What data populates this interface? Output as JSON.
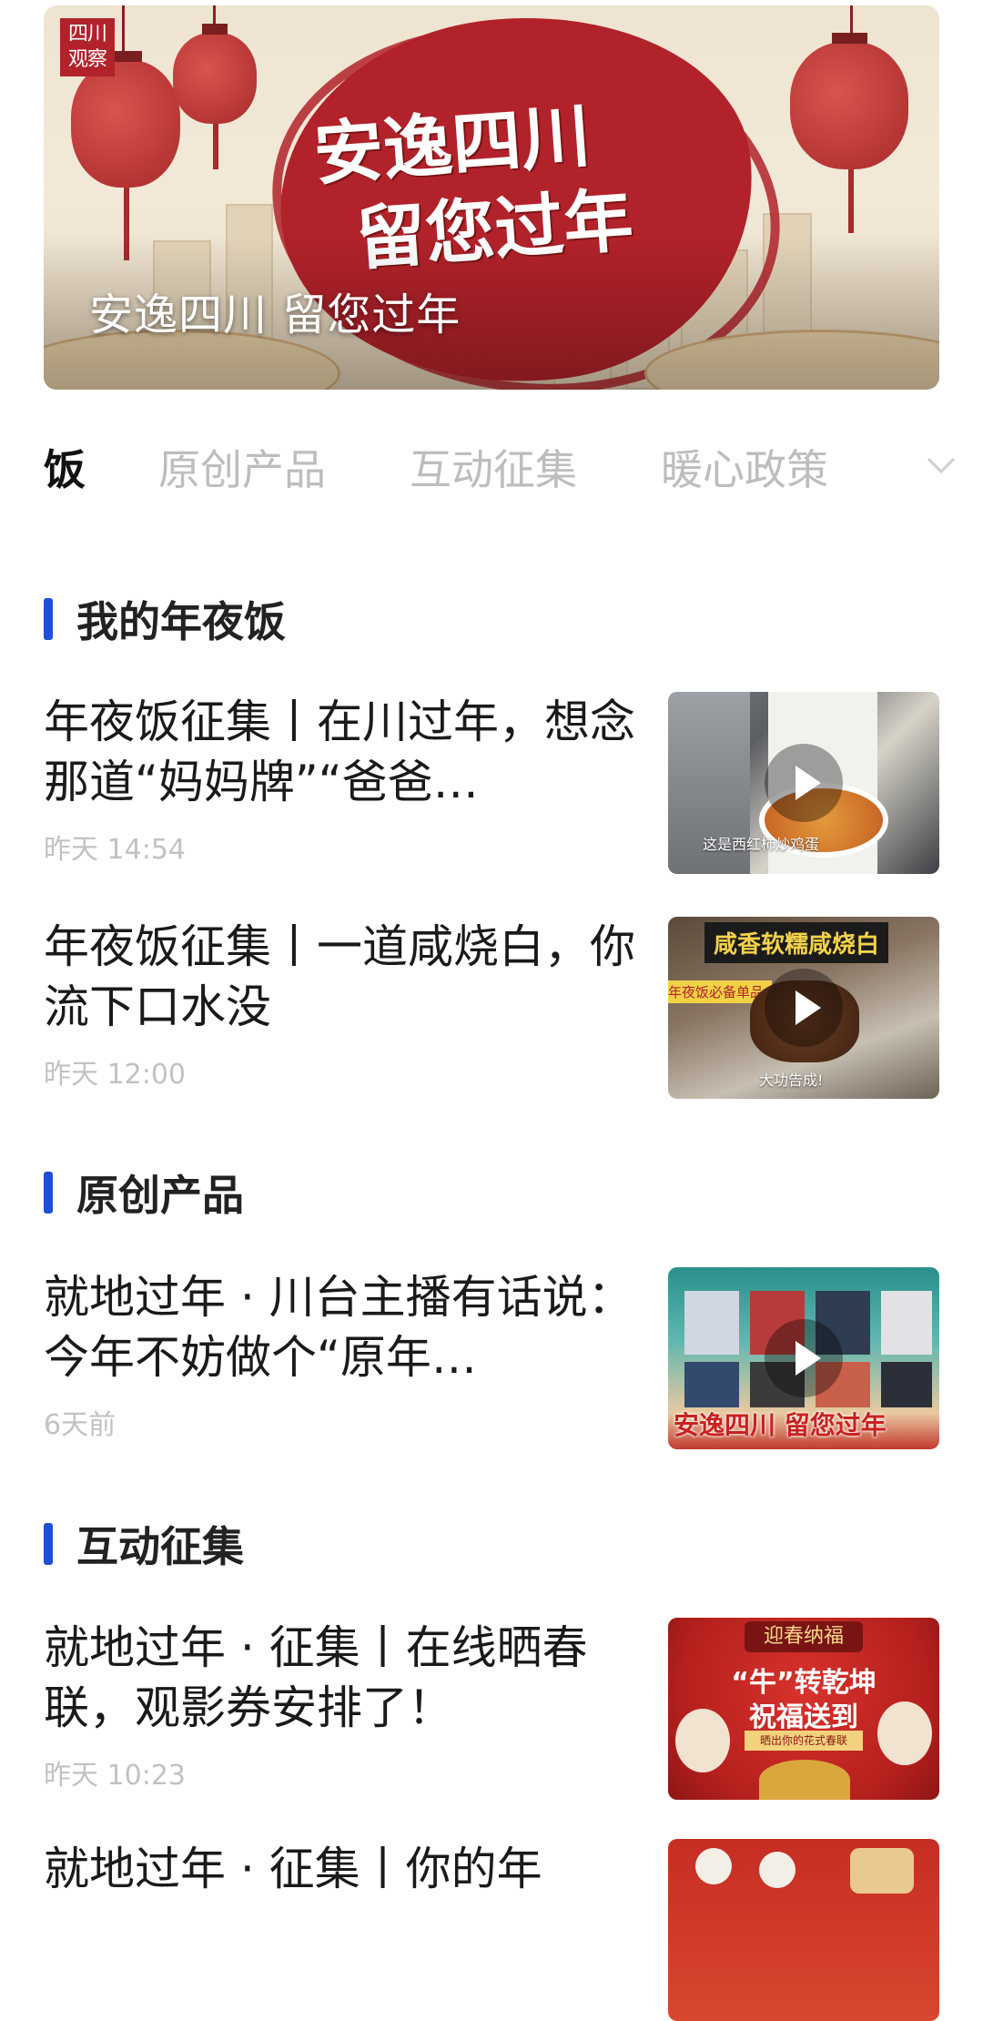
{
  "banner": {
    "logo_text": "四川\n观察",
    "calligraphy_line1": "安逸四川",
    "calligraphy_line2": "留您过年",
    "caption": "安逸四川  留您过年"
  },
  "tabs": [
    {
      "label": "饭",
      "active": true
    },
    {
      "label": "原创产品",
      "active": false
    },
    {
      "label": "互动征集",
      "active": false
    },
    {
      "label": "暖心政策",
      "active": false
    }
  ],
  "tabs_more_icon": "chevron-down-icon",
  "sections": [
    {
      "title": "我的年夜饭",
      "articles": [
        {
          "title": "年夜饭征集丨在川过年，想念那道“妈妈牌”“爸爸…",
          "time": "昨天 14:54",
          "thumb": {
            "video": true,
            "caption": "这是西红柿炒鸡蛋"
          }
        },
        {
          "title": "年夜饭征集丨一道咸烧白，你流下口水没",
          "time": "昨天 12:00",
          "thumb": {
            "video": true,
            "caption": "大功告成!",
            "headline": "咸香软糯咸烧白",
            "side": "年夜饭必备单品"
          }
        }
      ]
    },
    {
      "title": "原创产品",
      "articles": [
        {
          "title": "就地过年 · 川台主播有话说：今年不妨做个“原年…",
          "time": "6天前",
          "thumb": {
            "video": true,
            "caption": "安逸四川 留您过年"
          }
        }
      ]
    },
    {
      "title": "互动征集",
      "articles": [
        {
          "title": "就地过年 · 征集丨在线晒春联，观影券安排了！",
          "time": "昨天 10:23",
          "thumb": {
            "video": false,
            "top": "迎春纳福",
            "line1": "“牛”转乾坤",
            "line2": "祝福送到",
            "sub": "晒出你的花式春联"
          }
        },
        {
          "title": "就地过年 · 征集丨你的年",
          "time": "",
          "thumb": {
            "video": false
          }
        }
      ]
    }
  ],
  "colors": {
    "accent": "#1e4fd8",
    "banner_red": "#b2222a",
    "muted_text": "#c2c2c2"
  }
}
